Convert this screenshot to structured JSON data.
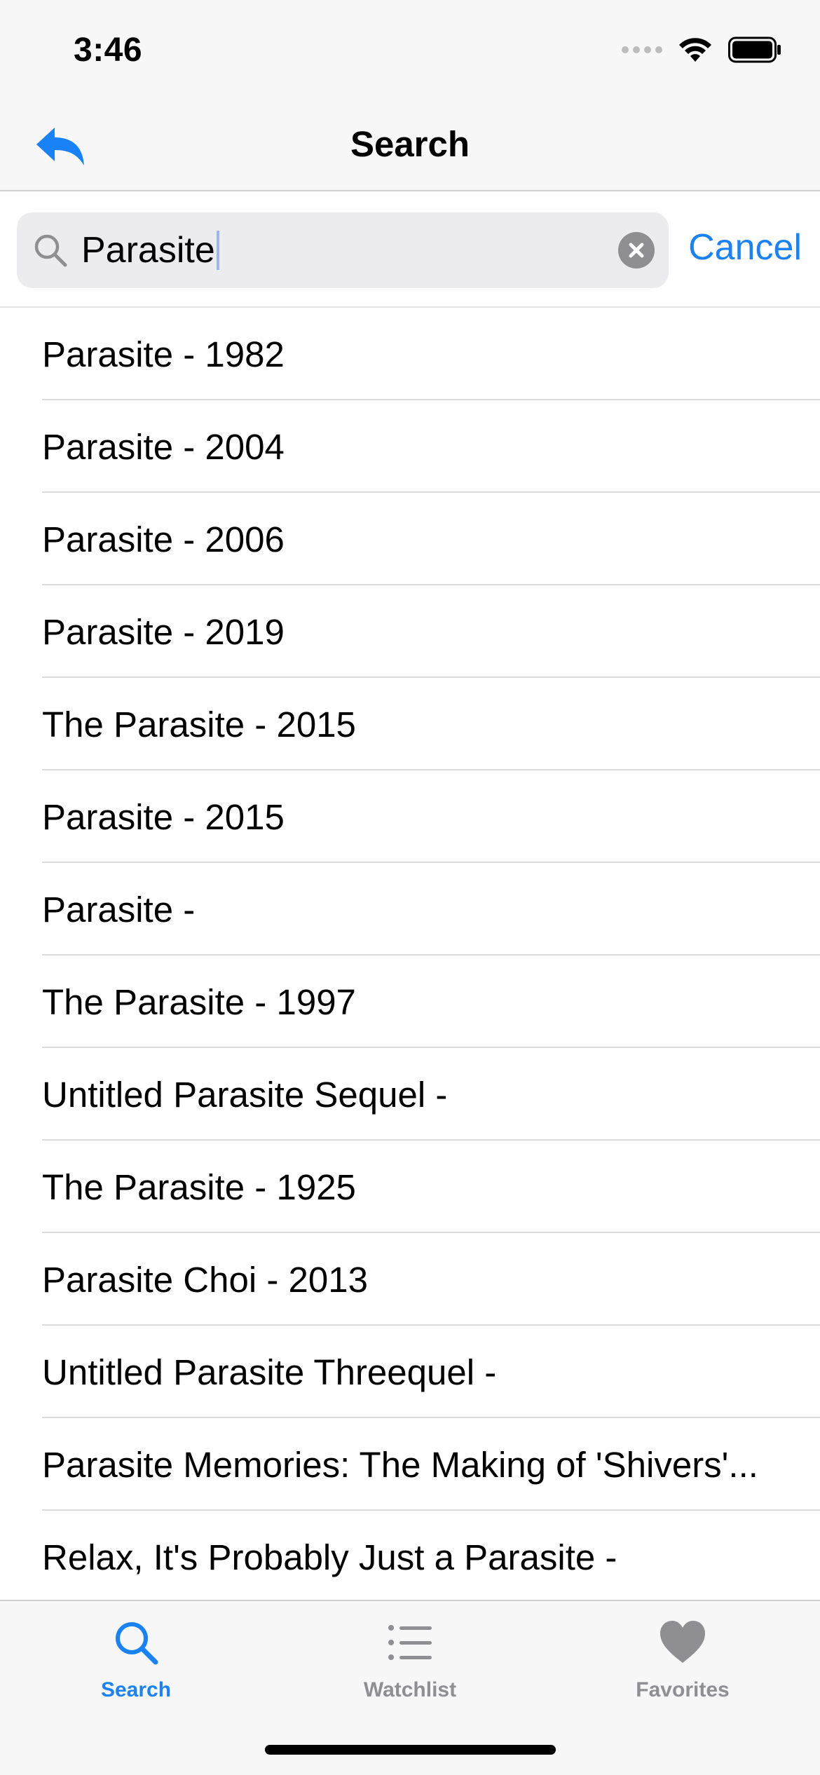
{
  "status_bar": {
    "time": "3:46"
  },
  "nav": {
    "title": "Search",
    "back_icon": "back-arrow-icon"
  },
  "search": {
    "value": "Parasite",
    "cancel_label": "Cancel"
  },
  "results": [
    "Parasite - 1982",
    "Parasite - 2004",
    "Parasite - 2006",
    "Parasite - 2019",
    "The Parasite - 2015",
    "Parasite - 2015",
    "Parasite -",
    "The Parasite - 1997",
    "Untitled Parasite Sequel -",
    "The Parasite - 1925",
    "Parasite Choi - 2013",
    "Untitled Parasite Threequel -",
    "Parasite Memories: The Making of 'Shivers'...",
    "Relax, It's Probably Just a Parasite -"
  ],
  "tabs": [
    {
      "label": "Search",
      "icon": "search-icon",
      "active": true
    },
    {
      "label": "Watchlist",
      "icon": "list-icon",
      "active": false
    },
    {
      "label": "Favorites",
      "icon": "heart-icon",
      "active": false
    }
  ],
  "colors": {
    "accent": "#1a82f7",
    "inactive": "#8e8e93"
  }
}
